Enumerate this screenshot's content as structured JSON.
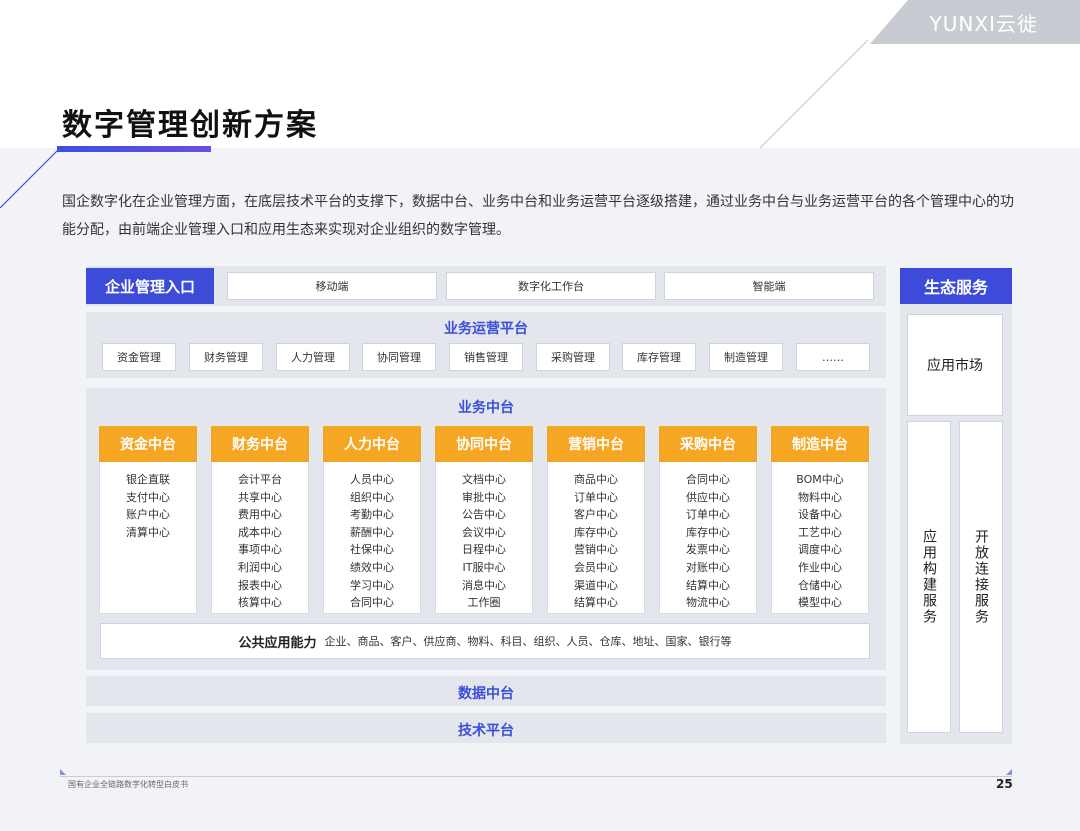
{
  "brand": {
    "logo_text": "YUNXI云徙"
  },
  "page": {
    "title": "数字管理创新方案",
    "intro": "国企数字化在企业管理方面，在底层技术平台的支撑下，数据中台、业务中台和业务运营平台逐级搭建，通过业务中台与业务运营平台的各个管理中心的功能分配，由前端企业管理入口和应用生态来实现对企业组织的数字管理。",
    "page_number": "25",
    "footer": "国有企业全链路数字化转型白皮书"
  },
  "colors": {
    "accent_blue": "#3c4bd8",
    "accent_orange": "#f5a623",
    "panel_gray": "#e4e6ee"
  },
  "entry": {
    "label": "企业管理入口",
    "items": [
      "移动端",
      "数字化工作台",
      "智能端"
    ]
  },
  "ops": {
    "title": "业务运营平台",
    "items": [
      "资金管理",
      "财务管理",
      "人力管理",
      "协同管理",
      "销售管理",
      "采购管理",
      "库存管理",
      "制造管理",
      "……"
    ]
  },
  "middle": {
    "title": "业务中台",
    "centers": [
      {
        "name": "资金中台",
        "items": [
          "银企直联",
          "支付中心",
          "账户中心",
          "清算中心"
        ]
      },
      {
        "name": "财务中台",
        "items": [
          "会计平台",
          "共享中心",
          "费用中心",
          "成本中心",
          "事项中心",
          "利润中心",
          "报表中心",
          "核算中心"
        ]
      },
      {
        "name": "人力中台",
        "items": [
          "人员中心",
          "组织中心",
          "考勤中心",
          "薪酬中心",
          "社保中心",
          "绩效中心",
          "学习中心",
          "合同中心"
        ]
      },
      {
        "name": "协同中台",
        "items": [
          "文档中心",
          "审批中心",
          "公告中心",
          "会议中心",
          "日程中心",
          "IT服中心",
          "消息中心",
          "工作圈"
        ]
      },
      {
        "name": "营销中台",
        "items": [
          "商品中心",
          "订单中心",
          "客户中心",
          "库存中心",
          "营销中心",
          "会员中心",
          "渠道中心",
          "结算中心"
        ]
      },
      {
        "name": "采购中台",
        "items": [
          "合同中心",
          "供应中心",
          "订单中心",
          "库存中心",
          "发票中心",
          "对账中心",
          "结算中心",
          "物流中心"
        ]
      },
      {
        "name": "制造中台",
        "items": [
          "BOM中心",
          "物料中心",
          "设备中心",
          "工艺中心",
          "调度中心",
          "作业中心",
          "仓储中心",
          "模型中心"
        ]
      }
    ],
    "public_title": "公共应用能力",
    "public_text": "企业、商品、客户、供应商、物料、科目、组织、人员、仓库、地址、国家、银行等"
  },
  "data_platform": "数据中台",
  "tech_platform": "技术平台",
  "eco": {
    "title": "生态服务",
    "market": "应用市场",
    "build": "应用构建服务",
    "connect": "开放连接服务"
  }
}
